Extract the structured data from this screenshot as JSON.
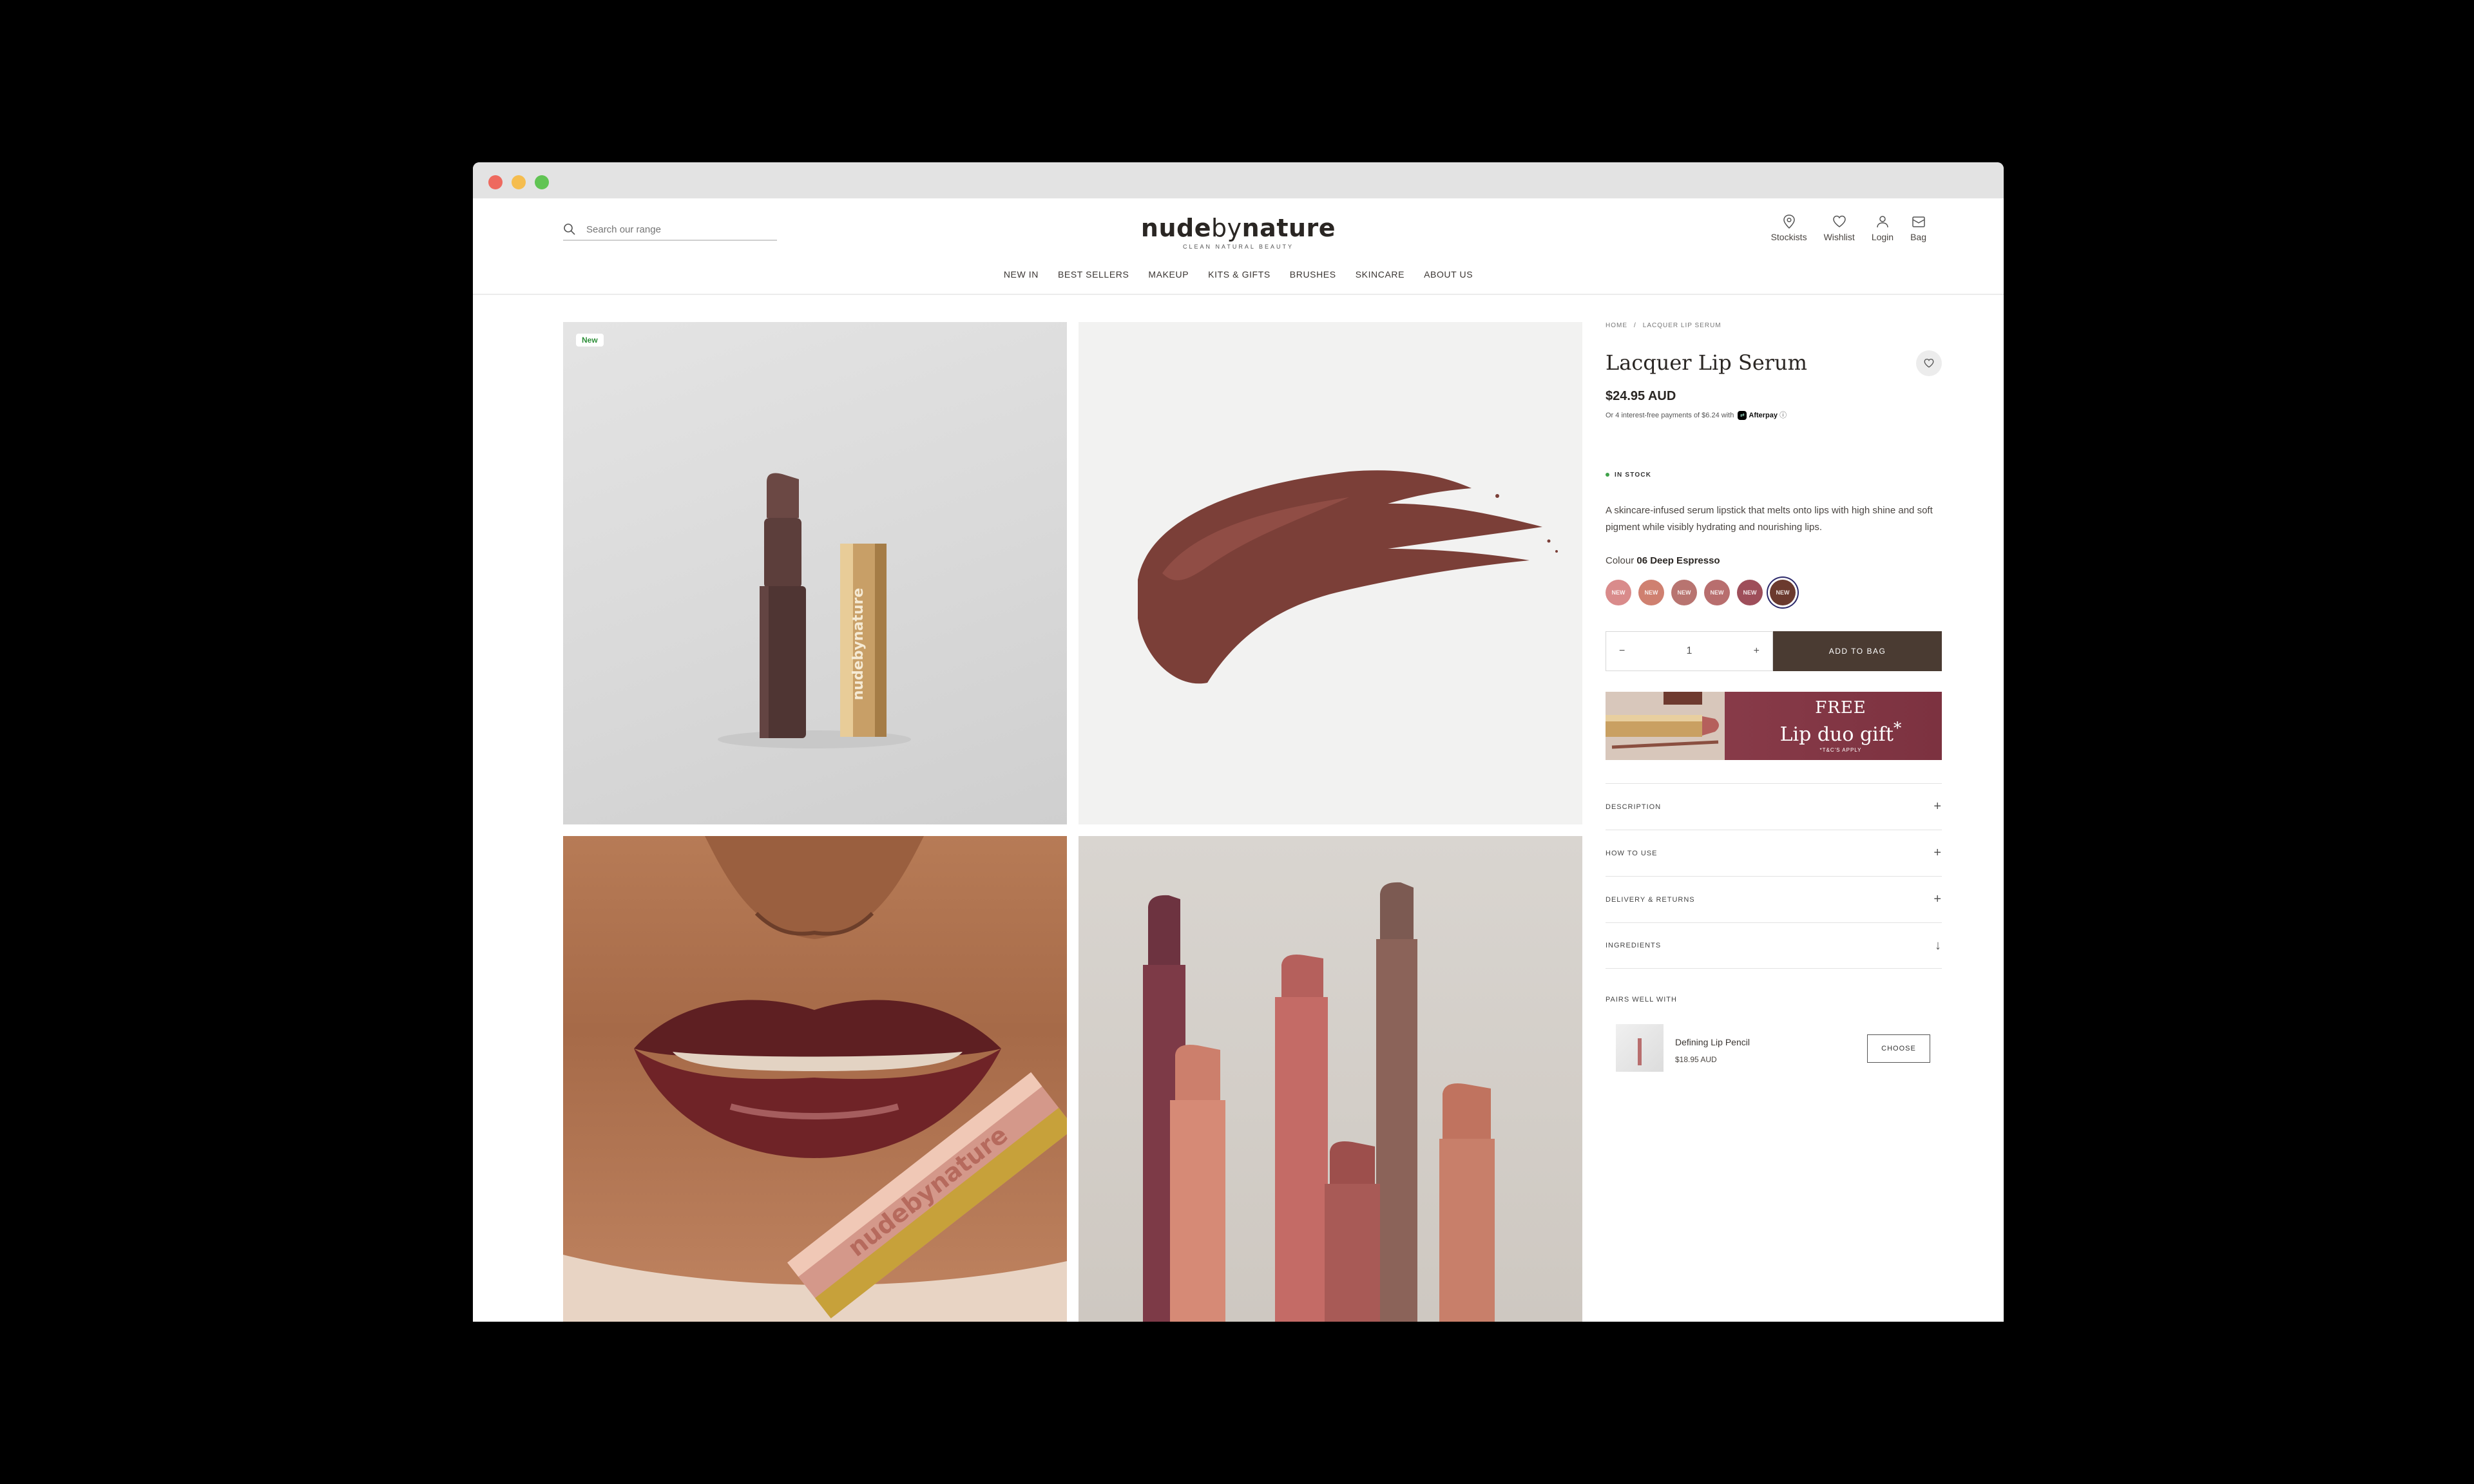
{
  "header": {
    "search_placeholder": "Search our range",
    "logo": {
      "part1": "nude",
      "part2": "by",
      "part3": "nature",
      "tagline": "CLEAN NATURAL BEAUTY"
    },
    "utils": [
      {
        "label": "Stockists",
        "icon": "map-pin-icon"
      },
      {
        "label": "Wishlist",
        "icon": "heart-icon"
      },
      {
        "label": "Login",
        "icon": "user-icon"
      },
      {
        "label": "Bag",
        "icon": "bag-icon"
      }
    ]
  },
  "nav": [
    "NEW IN",
    "BEST SELLERS",
    "MAKEUP",
    "KITS & GIFTS",
    "BRUSHES",
    "SKINCARE",
    "ABOUT US"
  ],
  "gallery": {
    "badge": "New"
  },
  "product": {
    "breadcrumb": [
      "HOME",
      "/",
      "LACQUER LIP SERUM"
    ],
    "title": "Lacquer Lip Serum",
    "price": "$24.95 AUD",
    "afterpay_text": "Or 4 interest-free payments of $6.24 with",
    "afterpay_brand": "Afterpay",
    "afterpay_info": "ⓘ",
    "stock": "IN STOCK",
    "description": "A skincare-infused serum lipstick that melts onto lips with high shine and soft pigment while visibly hydrating and nourishing lips.",
    "colour_label": "Colour",
    "colour_value": "06 Deep Espresso",
    "swatches": [
      {
        "label": "NEW",
        "color": "#d98b8b"
      },
      {
        "label": "NEW",
        "color": "#cf8070"
      },
      {
        "label": "NEW",
        "color": "#b87470"
      },
      {
        "label": "NEW",
        "color": "#b86e6e"
      },
      {
        "label": "NEW",
        "color": "#9e4e5a"
      },
      {
        "label": "NEW",
        "color": "#6b3a2e",
        "active": true
      }
    ],
    "quantity": {
      "minus": "−",
      "value": "1",
      "plus": "+"
    },
    "add_to_bag": "ADD TO BAG",
    "promo": {
      "free": "FREE",
      "gift": "Lip duo gift",
      "sup": "*",
      "tcs": "*T&C'S APPLY"
    },
    "accordions": [
      {
        "label": "DESCRIPTION",
        "sign": "+"
      },
      {
        "label": "HOW TO USE",
        "sign": "+"
      },
      {
        "label": "DELIVERY & RETURNS",
        "sign": "+"
      },
      {
        "label": "INGREDIENTS",
        "sign": "↓"
      }
    ],
    "pairs_title": "PAIRS WELL WITH",
    "pair": {
      "name": "Defining Lip Pencil",
      "price": "$18.95 AUD",
      "button": "CHOOSE"
    }
  }
}
